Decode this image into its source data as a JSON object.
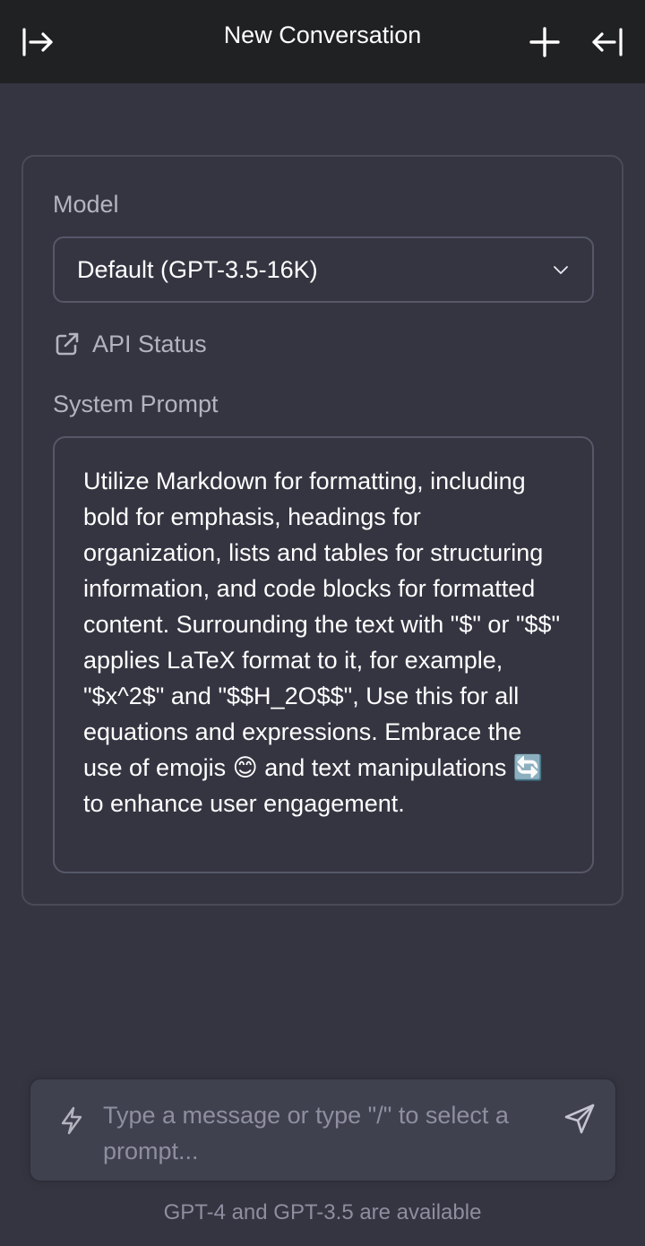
{
  "header": {
    "title": "New Conversation",
    "open_sidebar_icon": "arrow-right-to-bar-icon",
    "new_chat_icon": "plus-icon",
    "close_panel_icon": "arrow-left-to-bar-icon"
  },
  "settings": {
    "model_label": "Model",
    "model_value": "Default (GPT-3.5-16K)",
    "api_status_label": "API Status",
    "system_prompt_label": "System Prompt",
    "system_prompt_text": "Utilize Markdown for formatting, including bold for emphasis, headings for organization, lists and tables for structuring information, and code blocks for formatted content. Surrounding the text with \"$\" or \"$$\" applies LaTeX format to it, for example, \"$x^2$\" and \"$$H_2O$$\", Use this for all equations and expressions. Embrace the use of emojis 😊 and text manipulations 🔄 to enhance user engagement."
  },
  "composer": {
    "placeholder": "Type a message or type \"/\" to select a prompt...",
    "prompt_icon": "bolt-icon",
    "send_icon": "send-icon"
  },
  "footer": {
    "note": "GPT-4 and GPT-3.5 are available"
  },
  "colors": {
    "background": "#343541",
    "header": "#202123",
    "composer": "#40414f",
    "border": "#565869",
    "muted_text": "#b4b4bf"
  }
}
